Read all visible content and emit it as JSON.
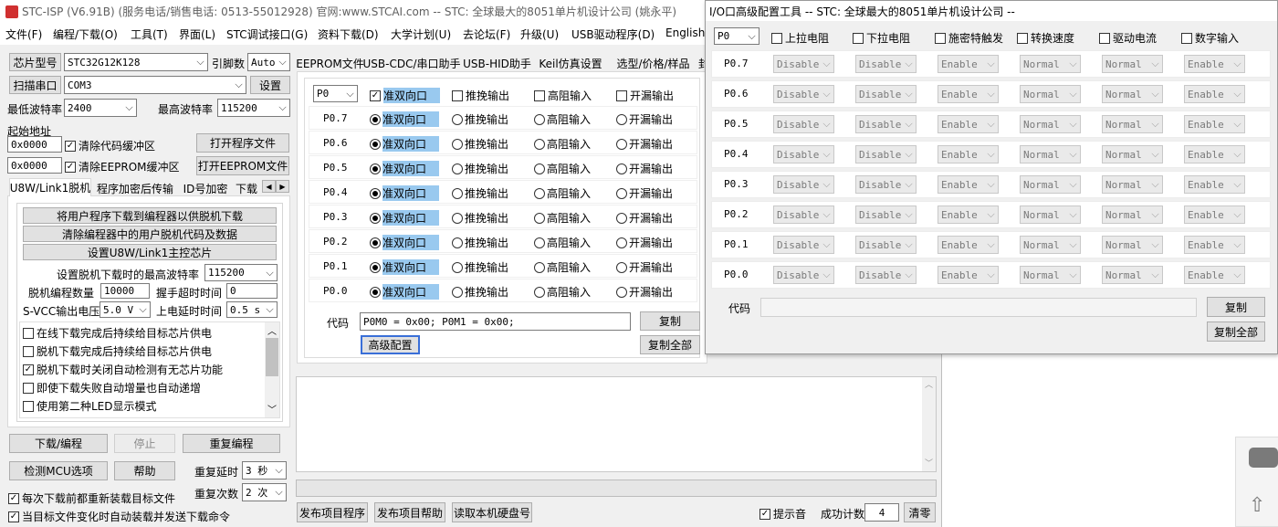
{
  "main_window": {
    "title": "STC-ISP (V6.91B) (服务电话/销售电话: 0513-55012928) 官网:www.STCAI.com  -- STC: 全球最大的8051单片机设计公司 (姚永平)",
    "menu": [
      "文件(F)",
      "编程/下载(O)",
      "工具(T)",
      "界面(L)",
      "STC调试接口(G)",
      "资料下载(D)",
      "大学计划(U)",
      "去论坛(F)",
      "升级(U)",
      "USB驱动程序(D)",
      "English"
    ]
  },
  "left": {
    "chip_label": "芯片型号",
    "chip_value": "STC32G12K128",
    "pins_label": "引脚数",
    "pins_value": "Auto",
    "scan_button": "扫描串口",
    "port_value": "COM3",
    "settings_button": "设置",
    "min_baud_label": "最低波特率",
    "min_baud_value": "2400",
    "max_baud_label": "最高波特率",
    "max_baud_value": "115200",
    "start_addr_label": "起始地址",
    "addr1": "0x0000",
    "clear_code_label": "清除代码缓冲区",
    "open_prog_button": "打开程序文件",
    "addr2": "0x0000",
    "clear_eeprom_label": "清除EEPROM缓冲区",
    "open_eeprom_button": "打开EEPROM文件",
    "tabs": [
      "U8W/Link1脱机",
      "程序加密后传输",
      "ID号加密",
      "下载"
    ],
    "offline": {
      "btn1": "将用户程序下载到编程器以供脱机下载",
      "btn2": "清除编程器中的用户脱机代码及数据",
      "btn3": "设置U8W/Link1主控芯片",
      "max_baud_label": "设置脱机下载时的最高波特率",
      "max_baud_value": "115200",
      "count_label": "脱机编程数量",
      "count_value": "10000",
      "timeout_label": "握手超时时间",
      "timeout_value": "0",
      "vcc_label": "S-VCC输出电压",
      "vcc_value": "5.0 V",
      "delay_label": "上电延时时间",
      "delay_value": "0.5 s",
      "options": [
        {
          "label": "在线下载完成后持续给目标芯片供电",
          "checked": false
        },
        {
          "label": "脱机下载完成后持续给目标芯片供电",
          "checked": false
        },
        {
          "label": "脱机下载时关闭自动检测有无芯片功能",
          "checked": true
        },
        {
          "label": "即使下载失败自动增量也自动递增",
          "checked": false
        },
        {
          "label": "使用第二种LED显示模式",
          "checked": false
        }
      ]
    },
    "download_button": "下载/编程",
    "stop_button": "停止",
    "reprogram_button": "重复编程",
    "detect_button": "检测MCU选项",
    "help_button": "帮助",
    "repeat_delay_label": "重复延时",
    "repeat_delay_value": "3 秒",
    "repeat_count_label": "重复次数",
    "repeat_count_value": "2 次",
    "reload_label": "每次下载前都重新装载目标文件",
    "auto_load_label": "当目标文件变化时自动装载并发送下载命令"
  },
  "center": {
    "tabs": [
      "EEPROM文件",
      "USB-CDC/串口助手",
      "USB-HID助手",
      "Keil仿真设置",
      "选型/价格/样品",
      "封"
    ],
    "port_select": "P0",
    "modes": [
      "准双向口",
      "推挽输出",
      "高阻输入",
      "开漏输出"
    ],
    "pins": [
      "P0.7",
      "P0.6",
      "P0.5",
      "P0.4",
      "P0.3",
      "P0.2",
      "P0.1",
      "P0.0"
    ],
    "code_label": "代码",
    "code_value": "P0M0 = 0x00;  P0M1 = 0x00;",
    "copy_button": "复制",
    "advanced_button": "高级配置",
    "copy_all_button": "复制全部",
    "publish_button": "发布项目程序",
    "publish_help_button": "发布项目帮助",
    "read_disk_button": "读取本机硬盘号",
    "beep_label": "提示音",
    "success_label": "成功计数",
    "success_value": "4",
    "clear_button": "清零"
  },
  "io_window": {
    "title": "I/O口高级配置工具 -- STC: 全球最大的8051单片机设计公司 --",
    "port_select": "P0",
    "headers": [
      "上拉电阻",
      "下拉电阻",
      "施密特触发",
      "转换速度",
      "驱动电流",
      "数字输入"
    ],
    "pins": [
      "P0.7",
      "P0.6",
      "P0.5",
      "P0.4",
      "P0.3",
      "P0.2",
      "P0.1",
      "P0.0"
    ],
    "values": [
      "Disable",
      "Disable",
      "Enable",
      "Normal",
      "Normal",
      "Enable"
    ],
    "code_label": "代码",
    "code_value": "",
    "copy_button": "复制",
    "copy_all_button": "复制全部"
  },
  "colors": {
    "selection": "#99c9ef",
    "button": "#e1e1e1",
    "border": "#adadad",
    "window_bg": "#f0f0f0"
  }
}
